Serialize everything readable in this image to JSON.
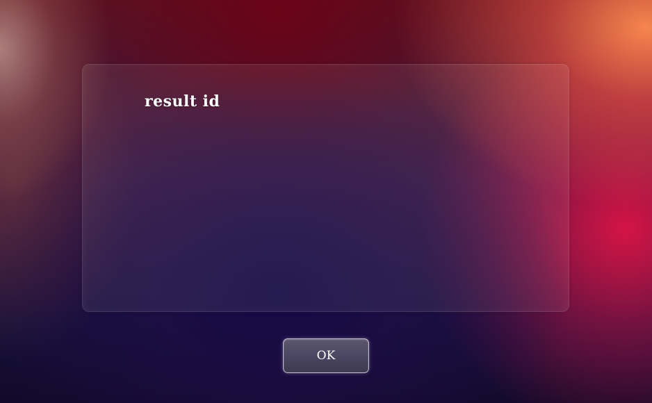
{
  "dialog": {
    "message": "result id",
    "ok_label": "OK"
  },
  "colors": {
    "panel_tint": "#ffffff",
    "text": "#ffffff",
    "button_fill": "#4a4560",
    "button_border": "#dcd2e6"
  }
}
